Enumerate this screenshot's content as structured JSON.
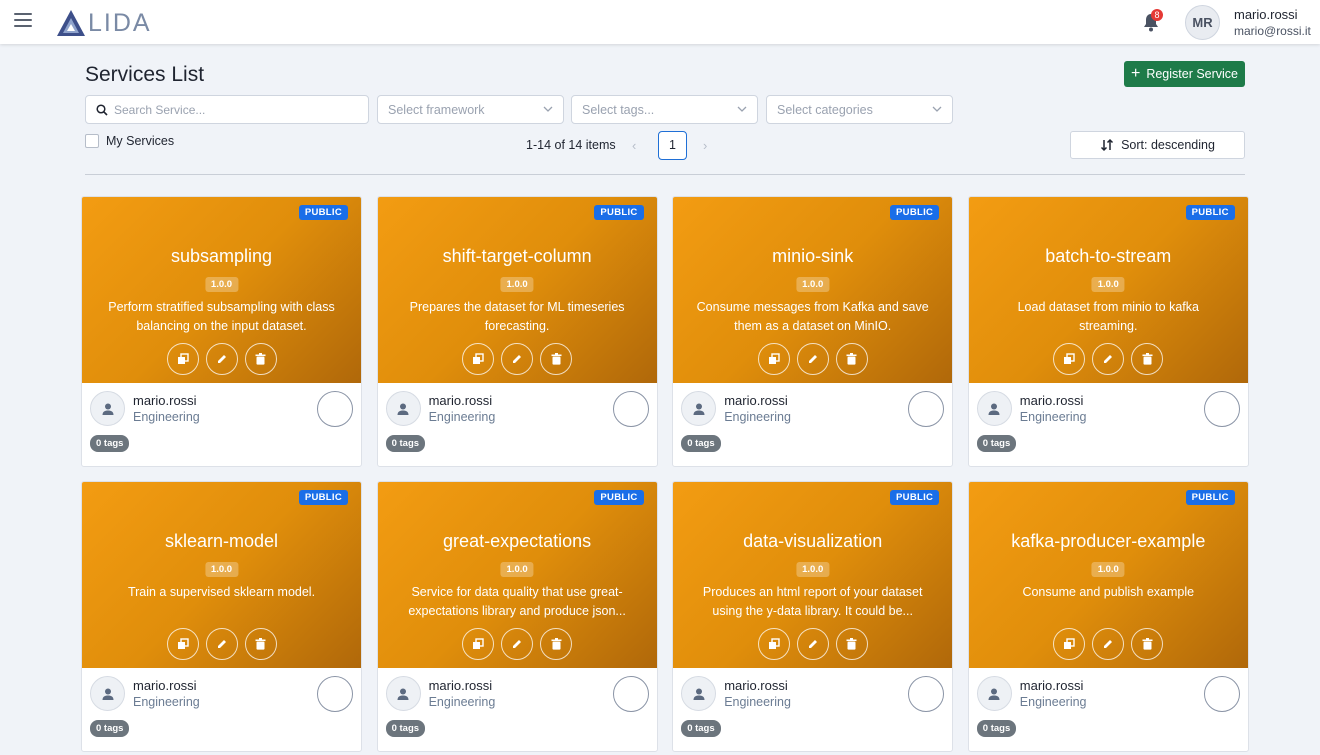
{
  "header": {
    "logo_text": "LIDA",
    "notifications_count": "8",
    "user_initials": "MR",
    "user_name": "mario.rossi",
    "user_email": "mario@rossi.it"
  },
  "toolbar": {
    "title": "Services List",
    "register_label": "Register Service",
    "search_placeholder": "Search Service...",
    "framework_placeholder": "Select framework",
    "tags_placeholder": "Select tags...",
    "categories_placeholder": "Select categories",
    "my_services_label": "My Services",
    "pagination_text": "1-14 of 14 items",
    "current_page": "1",
    "sort_label": "Sort: descending"
  },
  "colors": {
    "accent_green": "#1e7b49",
    "public_badge": "#1a6ee8",
    "card_gradient_start": "#f39c12",
    "card_gradient_end": "#b0680a"
  },
  "services": [
    {
      "name": "subsampling",
      "version": "1.0.0",
      "visibility": "PUBLIC",
      "description": "Perform stratified subsampling with class balancing on the input dataset.",
      "owner": "mario.rossi",
      "team": "Engineering",
      "tags": "0 tags"
    },
    {
      "name": "shift-target-column",
      "version": "1.0.0",
      "visibility": "PUBLIC",
      "description": "Prepares the dataset for ML timeseries forecasting.",
      "owner": "mario.rossi",
      "team": "Engineering",
      "tags": "0 tags"
    },
    {
      "name": "minio-sink",
      "version": "1.0.0",
      "visibility": "PUBLIC",
      "description": "Consume messages from Kafka and save them as a dataset on MinIO.",
      "owner": "mario.rossi",
      "team": "Engineering",
      "tags": "0 tags"
    },
    {
      "name": "batch-to-stream",
      "version": "1.0.0",
      "visibility": "PUBLIC",
      "description": "Load dataset from minio to kafka streaming.",
      "owner": "mario.rossi",
      "team": "Engineering",
      "tags": "0 tags"
    },
    {
      "name": "sklearn-model",
      "version": "1.0.0",
      "visibility": "PUBLIC",
      "description": "Train a supervised sklearn model.",
      "owner": "mario.rossi",
      "team": "Engineering",
      "tags": "0 tags"
    },
    {
      "name": "great-expectations",
      "version": "1.0.0",
      "visibility": "PUBLIC",
      "description": "Service for data quality that use great-expectations library and produce json...",
      "owner": "mario.rossi",
      "team": "Engineering",
      "tags": "0 tags"
    },
    {
      "name": "data-visualization",
      "version": "1.0.0",
      "visibility": "PUBLIC",
      "description": "Produces an html report of your dataset using the y-data library. It could be...",
      "owner": "mario.rossi",
      "team": "Engineering",
      "tags": "0 tags"
    },
    {
      "name": "kafka-producer-example",
      "version": "1.0.0",
      "visibility": "PUBLIC",
      "description": "Consume and publish example",
      "owner": "mario.rossi",
      "team": "Engineering",
      "tags": "0 tags"
    }
  ]
}
